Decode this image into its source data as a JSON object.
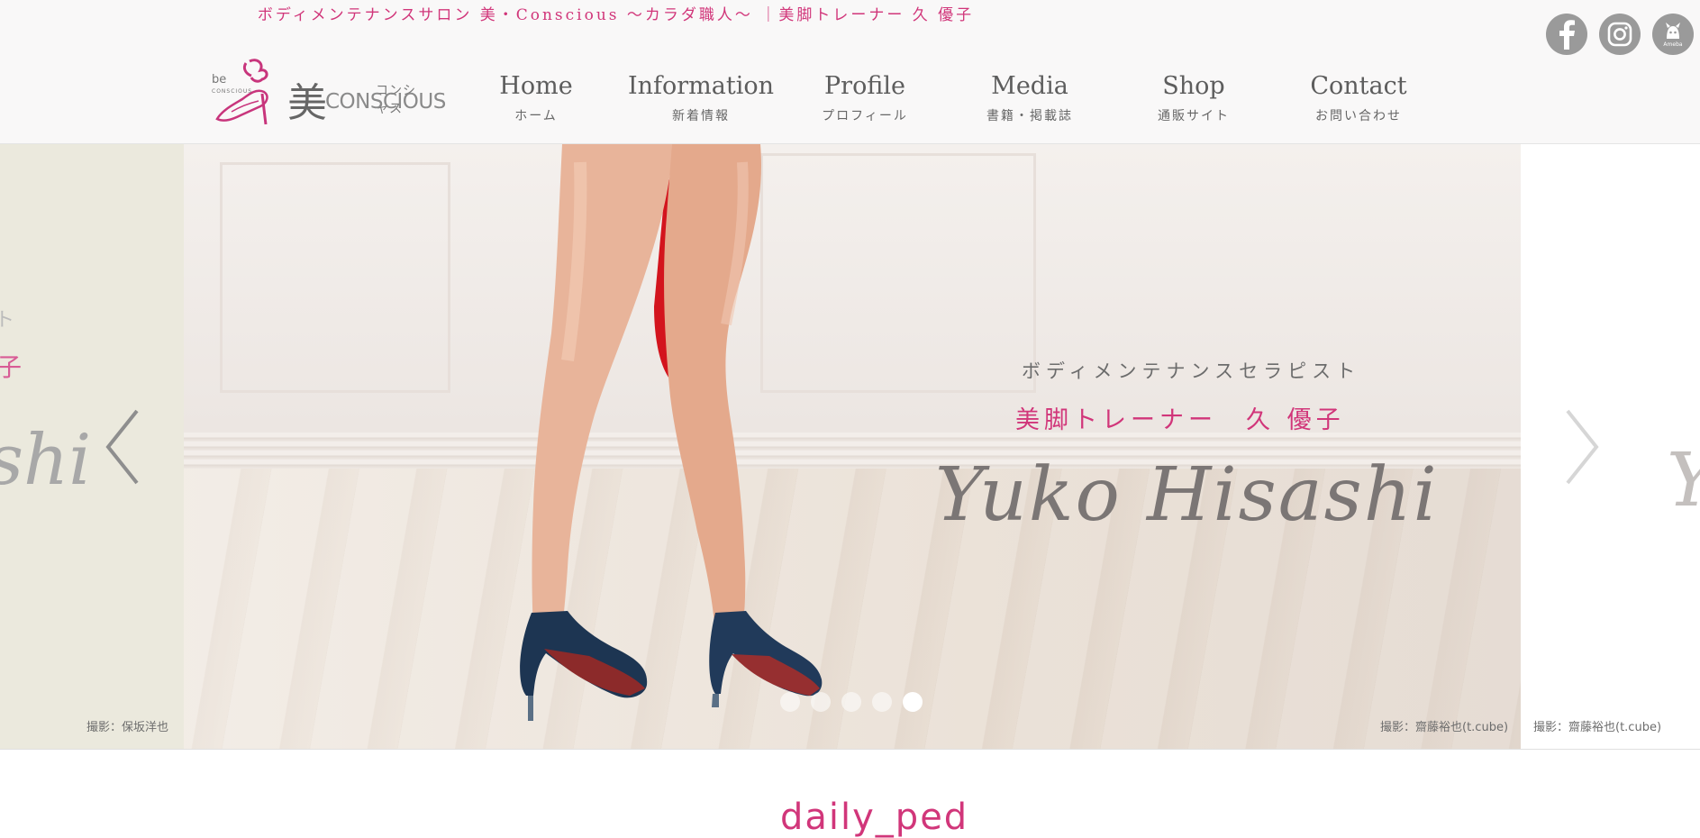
{
  "header": {
    "tagline": "ボディメンテナンスサロン 美・Conscious 〜カラダ職人〜 ｜美脚トレーナー 久 優子",
    "logo": {
      "be": "be",
      "be_small": "CONSCIOUS",
      "kanji": "美",
      "kana": "コンシャス",
      "word": "CONSCIOUS"
    },
    "nav": [
      {
        "en": "Home",
        "ja": "ホーム"
      },
      {
        "en": "Information",
        "ja": "新着情報"
      },
      {
        "en": "Profile",
        "ja": "プロフィール"
      },
      {
        "en": "Media",
        "ja": "書籍・掲載誌"
      },
      {
        "en": "Shop",
        "ja": "通販サイト"
      },
      {
        "en": "Contact",
        "ja": "お問い合わせ"
      }
    ],
    "social": [
      {
        "icon": "facebook-icon",
        "label": "f"
      },
      {
        "icon": "instagram-icon"
      },
      {
        "icon": "ameba-icon",
        "label": "Ameba"
      }
    ]
  },
  "slider": {
    "left_slide": {
      "fragment_top": "ト",
      "fragment_mid": "子",
      "fragment_script": "shi",
      "credit": "撮影：保坂洋也"
    },
    "main_slide": {
      "line1": "ボディメンテナンスセラピスト",
      "line2": "美脚トレーナー　久 優子",
      "script_name": "Yuko Hisashi",
      "credit": "撮影：齋藤裕也(t.cube)"
    },
    "right_slide": {
      "fragment_script": "Y",
      "credit": "撮影：齋藤裕也(t.cube)"
    },
    "dots_count": 5,
    "active_dot": 5,
    "accent_color": "#d1367a"
  },
  "below": {
    "partial_text": "daily_ped"
  }
}
